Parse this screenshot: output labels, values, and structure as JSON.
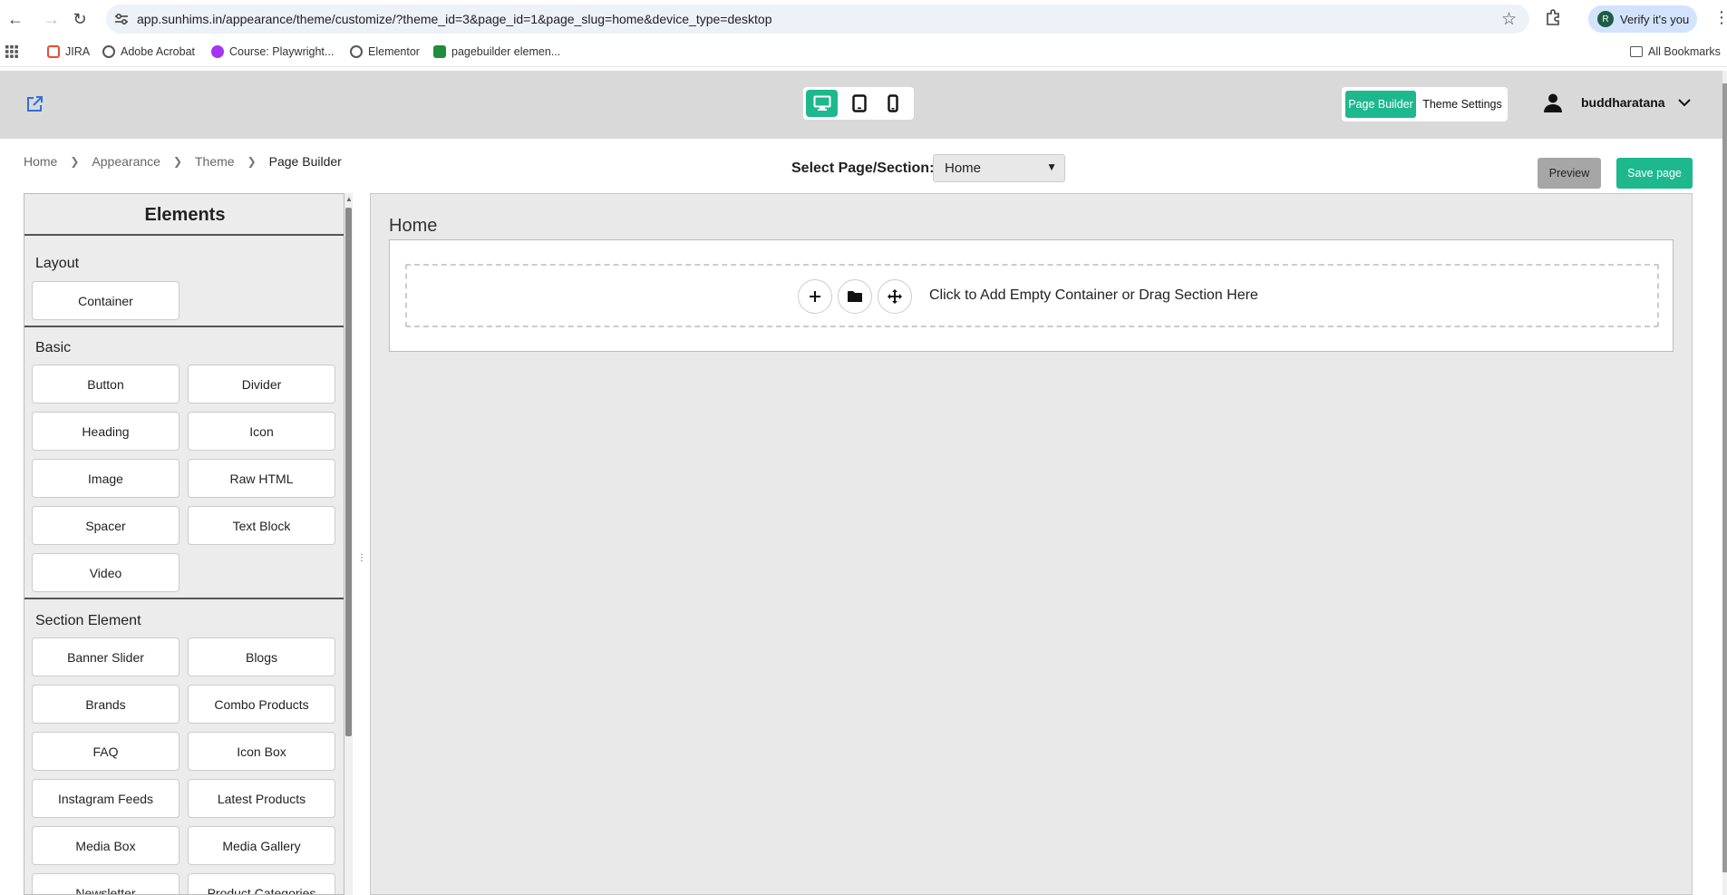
{
  "browser": {
    "url": "app.sunhims.in/appearance/theme/customize/?theme_id=3&page_id=1&page_slug=home&device_type=desktop",
    "profile_label": "Verify it's you",
    "profile_initial": "R",
    "bookmarks": [
      {
        "label": "JIRA",
        "color": "#e94b35"
      },
      {
        "label": "Adobe Acrobat",
        "color": "#555555"
      },
      {
        "label": "Course: Playwright...",
        "color": "#a435f0"
      },
      {
        "label": "Elementor",
        "color": "#555555"
      },
      {
        "label": "pagebuilder elemen...",
        "color": "#1e8e3e"
      }
    ],
    "all_bookmarks": "All Bookmarks"
  },
  "header": {
    "devices": [
      "desktop-icon",
      "tablet-icon",
      "mobile-icon"
    ],
    "active_device": "desktop",
    "mode_tabs": {
      "page_builder": "Page Builder",
      "theme_settings": "Theme Settings"
    },
    "username": "buddharatana"
  },
  "breadcrumb": {
    "items": [
      "Home",
      "Appearance",
      "Theme"
    ],
    "current": "Page Builder"
  },
  "toolbar": {
    "select_label": "Select Page/Section:",
    "select_value": "Home",
    "preview_label": "Preview",
    "save_label": "Save page"
  },
  "sidebar": {
    "title": "Elements",
    "sections": {
      "layout": {
        "title": "Layout",
        "items": [
          "Container"
        ]
      },
      "basic": {
        "title": "Basic",
        "items": [
          "Button",
          "Divider",
          "Heading",
          "Icon",
          "Image",
          "Raw HTML",
          "Spacer",
          "Text Block",
          "Video"
        ]
      },
      "section_element": {
        "title": "Section Element",
        "items": [
          "Banner Slider",
          "Blogs",
          "Brands",
          "Combo Products",
          "FAQ",
          "Icon Box",
          "Instagram Feeds",
          "Latest Products",
          "Media Box",
          "Media Gallery",
          "Newsletter",
          "Product Categories"
        ]
      }
    }
  },
  "canvas": {
    "title": "Home",
    "drop_text": "Click to Add Empty Container or Drag Section Here"
  },
  "colors": {
    "accent": "#1db88e",
    "preview": "#a6a6a6"
  }
}
